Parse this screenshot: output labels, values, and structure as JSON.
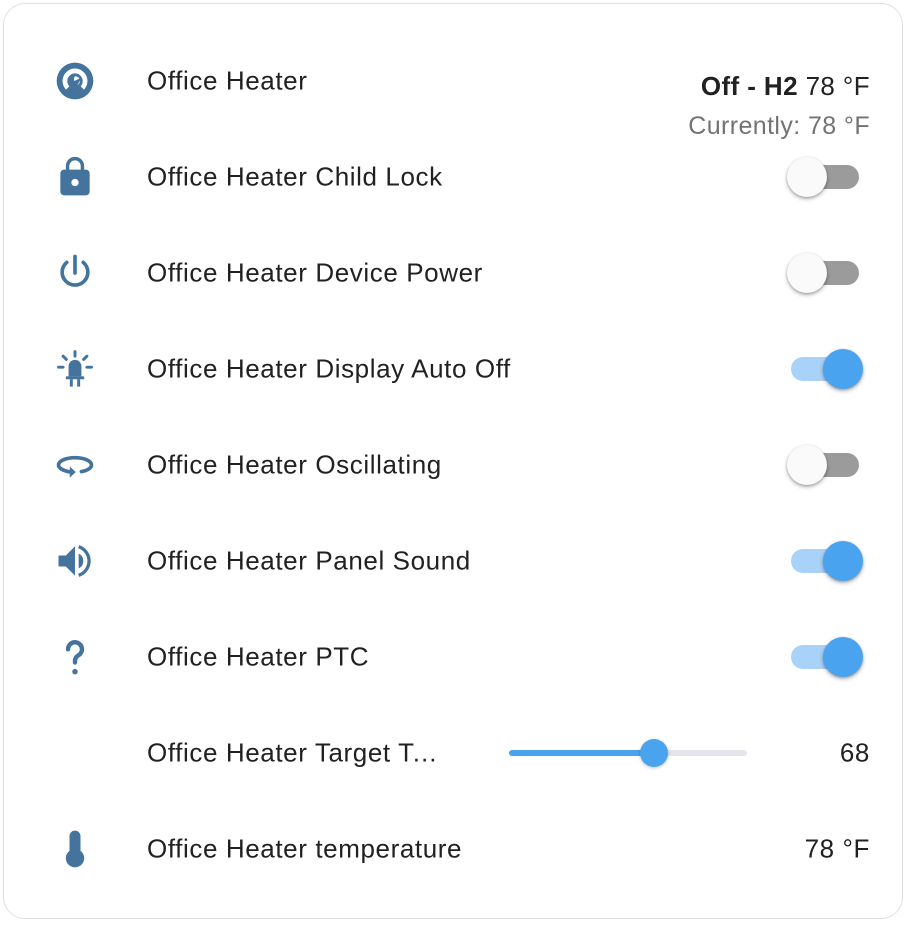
{
  "colors": {
    "icon": "#44739e",
    "accent": "#4aa3ee",
    "toggle_off": "#9b9b9b"
  },
  "rows": [
    {
      "icon": "thermostat-dial-icon",
      "name": "Office Heater",
      "mode": "Off - H2",
      "target": "78 °F",
      "current": "Currently: 78 °F"
    },
    {
      "icon": "lock-icon",
      "name": "Office Heater Child Lock",
      "on": false
    },
    {
      "icon": "power-icon",
      "name": "Office Heater Device Power",
      "on": false
    },
    {
      "icon": "led-bulb-icon",
      "name": "Office Heater Display Auto Off",
      "on": true
    },
    {
      "icon": "rotate-oscillate-icon",
      "name": "Office Heater Oscillating",
      "on": false
    },
    {
      "icon": "volume-icon",
      "name": "Office Heater Panel Sound",
      "on": true
    },
    {
      "icon": "question-mark-icon",
      "name": "Office Heater PTC",
      "on": true
    },
    {
      "name": "Office Heater Target Temperature",
      "value": "68",
      "level": 0.61
    },
    {
      "icon": "thermometer-icon",
      "name": "Office Heater temperature",
      "value": "78 °F"
    }
  ]
}
